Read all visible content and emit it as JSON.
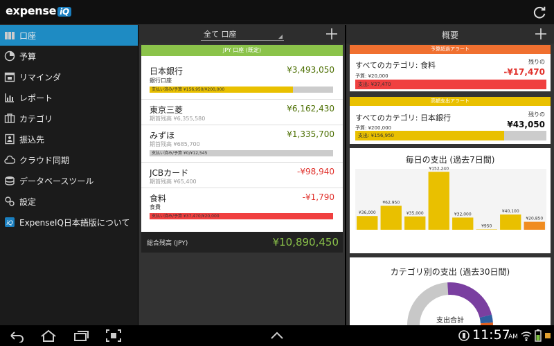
{
  "app": {
    "logo_text": "expense",
    "logo_badge": "iQ"
  },
  "sidebar": {
    "items": [
      {
        "label": "口座",
        "icon": "accounts-icon",
        "active": true
      },
      {
        "label": "予算",
        "icon": "budget-icon"
      },
      {
        "label": "リマインダ",
        "icon": "calendar-icon"
      },
      {
        "label": "レポート",
        "icon": "report-icon"
      },
      {
        "label": "カテゴリ",
        "icon": "category-icon"
      },
      {
        "label": "振込先",
        "icon": "payee-icon"
      },
      {
        "label": "クラウド同期",
        "icon": "cloud-icon"
      },
      {
        "label": "データベースツール",
        "icon": "database-icon"
      },
      {
        "label": "設定",
        "icon": "settings-icon"
      },
      {
        "label": "ExpenseIQ日本語版について",
        "icon": "app-logo-icon"
      }
    ]
  },
  "accounts_panel": {
    "filter_value": "全て 口座",
    "card_header": "JPY 口座 (既定)",
    "accounts": [
      {
        "name": "日本銀行",
        "sub": "銀行口座",
        "amount": "¥3,493,050",
        "negative": false,
        "bar_label": "支払い済み/予算 ¥156,950/¥200,000",
        "bar_fraction": 0.78,
        "bar_color": "#e9c000"
      },
      {
        "name": "東京三菱",
        "sub": "期首残高 ¥6,355,580",
        "amount": "¥6,162,430",
        "negative": false
      },
      {
        "name": "みずほ",
        "sub": "期首残高 ¥685,700",
        "amount": "¥1,335,700",
        "negative": false,
        "bar_label": "支払い済み/予算 ¥0/¥12,545",
        "bar_fraction": 0.0,
        "bar_color": "#e9c000"
      },
      {
        "name": "JCBカード",
        "sub": "期首残高 ¥65,400",
        "amount": "-¥98,940",
        "negative": true
      },
      {
        "name": "食料",
        "sub": "食費",
        "amount": "-¥1,790",
        "negative": true,
        "bar_label": "支払い済み/予算 ¥37,470/¥20,000",
        "bar_fraction": 1.0,
        "bar_color": "#f04040"
      }
    ],
    "total_label": "総合残高 (JPY)",
    "total_amount": "¥10,890,450"
  },
  "overview_panel": {
    "title": "概要",
    "over_budget_alert": {
      "header": "予算超過アラート",
      "header_color": "#f07030",
      "title": "すべてのカテゴリ: 食料",
      "remaining_label": "残りの",
      "remaining": "-¥17,470",
      "budget": "予算: ¥20,000",
      "bar_label": "支出: ¥37,470",
      "bar_fraction": 1.0,
      "bar_color": "#f04040"
    },
    "high_spend_alert": {
      "header": "高額支出アラート",
      "header_color": "#e9c000",
      "title": "すべてのカテゴリ: 日本銀行",
      "remaining_label": "残りの",
      "remaining": "¥43,050",
      "budget": "予算: ¥200,000",
      "bar_label": "支出: ¥156,950",
      "bar_fraction": 0.78,
      "bar_color": "#e9c000"
    },
    "daily_chart_title": "毎日の支出 (過去7日間)",
    "category_chart_title": "カテゴリ別の支出 (過去30日間)",
    "donut_center_label": "支出合計"
  },
  "chart_data": [
    {
      "type": "bar",
      "title": "毎日の支出 (過去7日間)",
      "categories": [
        "",
        "",
        "",
        "",
        "",
        "",
        "",
        ""
      ],
      "values": [
        36000,
        62950,
        35000,
        152240,
        32000,
        950,
        40100,
        20850
      ],
      "data_labels": [
        "¥36,000",
        "¥62,950",
        "¥35,000",
        "¥152,240",
        "¥32,000",
        "¥950",
        "¥40,100",
        "¥20,850"
      ],
      "colors": [
        "#e9c000",
        "#e9c000",
        "#e9c000",
        "#e9c000",
        "#e9c000",
        "#e9c000",
        "#e9c000",
        "#f08c20"
      ],
      "ylim": [
        0,
        160000
      ]
    },
    {
      "type": "pie",
      "title": "カテゴリ別の支出 (過去30日間)",
      "slices": [
        {
          "value": 0.33,
          "color": "#c8c8c8"
        },
        {
          "value": 0.22,
          "color": "#7a3fa0"
        },
        {
          "value": 0.03,
          "color": "#2e5fa0"
        },
        {
          "value": 0.03,
          "color": "#e06020"
        }
      ]
    }
  ],
  "statusbar": {
    "time": "11:57",
    "ampm": "AM"
  }
}
